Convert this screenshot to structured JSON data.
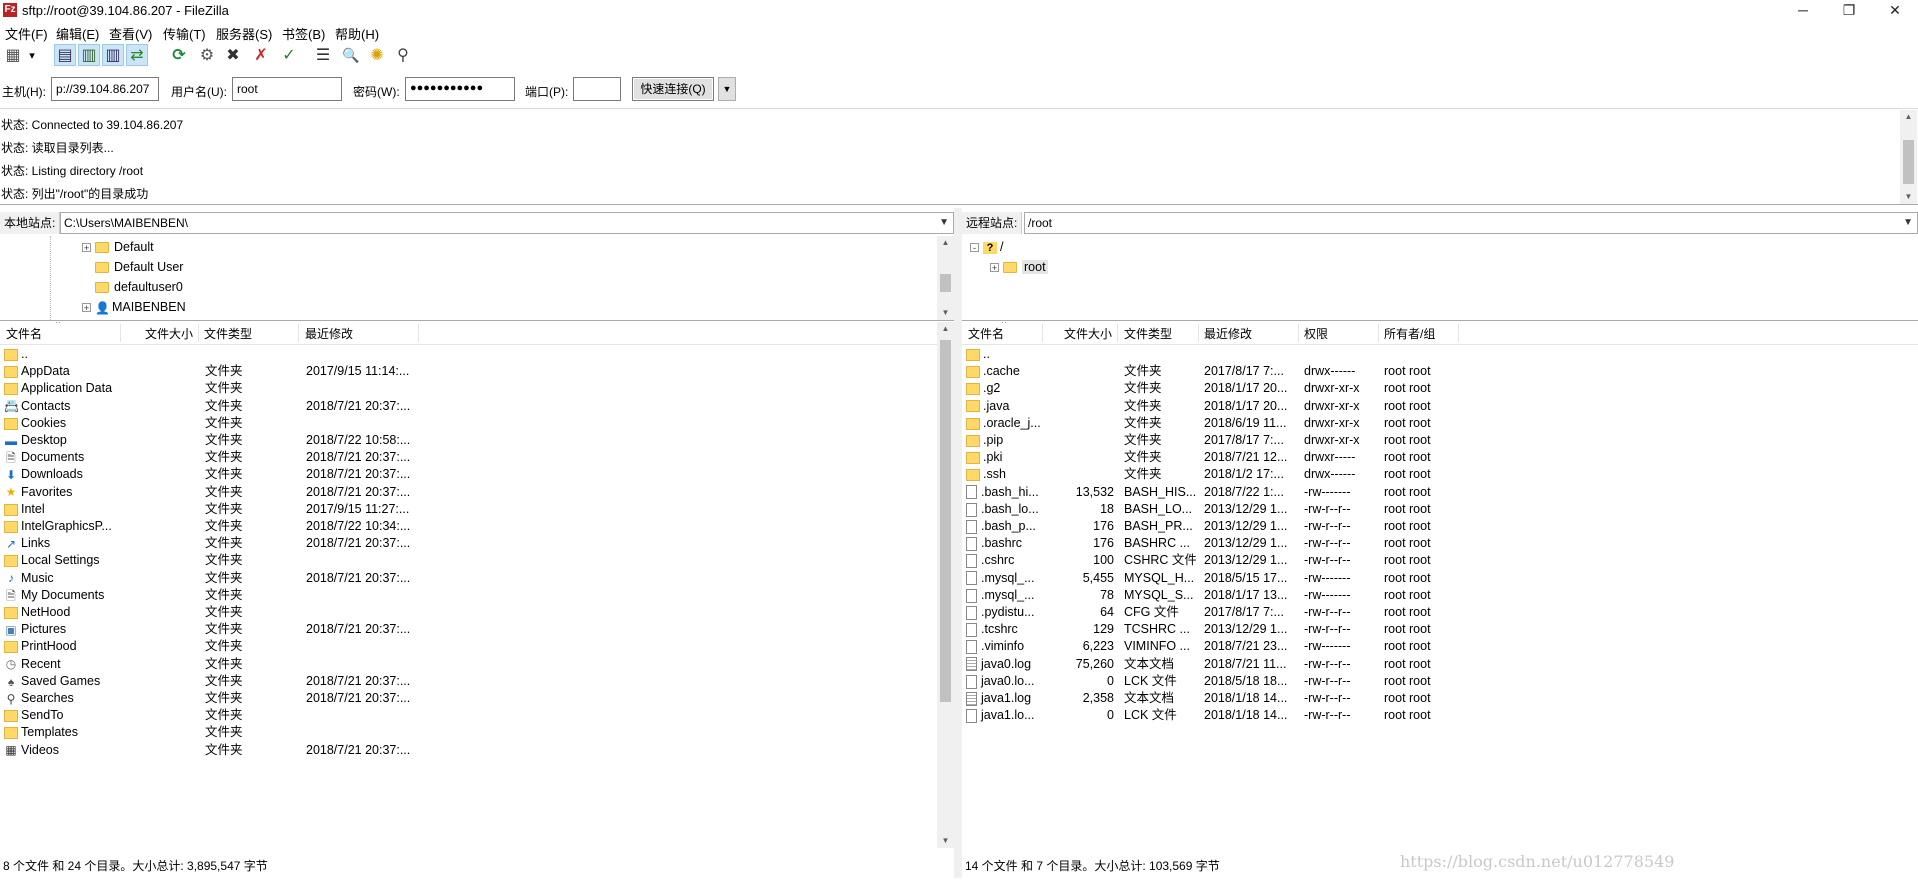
{
  "window": {
    "title": "sftp://root@39.104.86.207 - FileZilla",
    "app_icon": "Fz",
    "minimize": "─",
    "maximize": "❐",
    "close": "✕"
  },
  "menu": [
    "文件(F)",
    "编辑(E)",
    "查看(V)",
    "传输(T)",
    "服务器(S)",
    "书签(B)",
    "帮助(H)"
  ],
  "toolbar": [
    {
      "name": "site-manager-icon",
      "glyph": "▦"
    },
    {
      "name": "site-manager-dropdown-icon",
      "glyph": "▾"
    },
    {
      "name": "toggle-log-icon",
      "glyph": "▤"
    },
    {
      "name": "toggle-local-tree-icon",
      "glyph": "▥"
    },
    {
      "name": "toggle-remote-tree-icon",
      "glyph": "▥"
    },
    {
      "name": "toggle-queue-icon",
      "glyph": "⇄"
    },
    {
      "name": "refresh-icon",
      "glyph": "⟳"
    },
    {
      "name": "process-queue-icon",
      "glyph": "⚙"
    },
    {
      "name": "cancel-icon",
      "glyph": "✖"
    },
    {
      "name": "disconnect-icon",
      "glyph": "✗"
    },
    {
      "name": "reconnect-icon",
      "glyph": "✓"
    },
    {
      "name": "directory-comparison-icon",
      "glyph": "☰"
    },
    {
      "name": "filter-icon",
      "glyph": "🔍"
    },
    {
      "name": "sync-browsing-icon",
      "glyph": "✺"
    },
    {
      "name": "search-files-icon",
      "glyph": "⚲"
    }
  ],
  "quickconnect": {
    "host_label": "主机(H):",
    "host_value": "p://39.104.86.207",
    "user_label": "用户名(U):",
    "user_value": "root",
    "password_label": "密码(W):",
    "password_value": "●●●●●●●●●●●",
    "port_label": "端口(P):",
    "port_value": "",
    "button_label": "快速连接(Q)",
    "dropdown_glyph": "▼"
  },
  "log": [
    "状态: Connected to 39.104.86.207",
    "状态: 读取目录列表...",
    "状态: Listing directory /root",
    "状态: 列出\"/root\"的目录成功"
  ],
  "local": {
    "site_label": "本地站点:",
    "path": "C:\\Users\\MAIBENBEN\\",
    "tree": [
      {
        "label": "Default",
        "expander": "+",
        "icon": "folder"
      },
      {
        "label": "Default User",
        "expander": "",
        "icon": "folder"
      },
      {
        "label": "defaultuser0",
        "expander": "",
        "icon": "folder"
      },
      {
        "label": "MAIBENBEN",
        "expander": "+",
        "icon": "user"
      }
    ],
    "headers": [
      "文件名",
      "文件大小",
      "文件类型",
      "最近修改"
    ],
    "rows": [
      {
        "name": "..",
        "size": "",
        "type": "",
        "modified": "",
        "icon": "folder"
      },
      {
        "name": "AppData",
        "size": "",
        "type": "文件夹",
        "modified": "2017/9/15 11:14:...",
        "icon": "folder"
      },
      {
        "name": "Application Data",
        "size": "",
        "type": "文件夹",
        "modified": "",
        "icon": "folder"
      },
      {
        "name": "Contacts",
        "size": "",
        "type": "文件夹",
        "modified": "2018/7/21 20:37:...",
        "icon": "contacts"
      },
      {
        "name": "Cookies",
        "size": "",
        "type": "文件夹",
        "modified": "",
        "icon": "folder"
      },
      {
        "name": "Desktop",
        "size": "",
        "type": "文件夹",
        "modified": "2018/7/22 10:58:...",
        "icon": "desktop"
      },
      {
        "name": "Documents",
        "size": "",
        "type": "文件夹",
        "modified": "2018/7/21 20:37:...",
        "icon": "documents"
      },
      {
        "name": "Downloads",
        "size": "",
        "type": "文件夹",
        "modified": "2018/7/21 20:37:...",
        "icon": "downloads"
      },
      {
        "name": "Favorites",
        "size": "",
        "type": "文件夹",
        "modified": "2018/7/21 20:37:...",
        "icon": "star"
      },
      {
        "name": "Intel",
        "size": "",
        "type": "文件夹",
        "modified": "2017/9/15 11:27:...",
        "icon": "folder"
      },
      {
        "name": "IntelGraphicsP...",
        "size": "",
        "type": "文件夹",
        "modified": "2018/7/22 10:34:...",
        "icon": "folder"
      },
      {
        "name": "Links",
        "size": "",
        "type": "文件夹",
        "modified": "2018/7/21 20:37:...",
        "icon": "links"
      },
      {
        "name": "Local Settings",
        "size": "",
        "type": "文件夹",
        "modified": "",
        "icon": "folder"
      },
      {
        "name": "Music",
        "size": "",
        "type": "文件夹",
        "modified": "2018/7/21 20:37:...",
        "icon": "music"
      },
      {
        "name": "My Documents",
        "size": "",
        "type": "文件夹",
        "modified": "",
        "icon": "documents"
      },
      {
        "name": "NetHood",
        "size": "",
        "type": "文件夹",
        "modified": "",
        "icon": "folder"
      },
      {
        "name": "Pictures",
        "size": "",
        "type": "文件夹",
        "modified": "2018/7/21 20:37:...",
        "icon": "pictures"
      },
      {
        "name": "PrintHood",
        "size": "",
        "type": "文件夹",
        "modified": "",
        "icon": "folder"
      },
      {
        "name": "Recent",
        "size": "",
        "type": "文件夹",
        "modified": "",
        "icon": "recent"
      },
      {
        "name": "Saved Games",
        "size": "",
        "type": "文件夹",
        "modified": "2018/7/21 20:37:...",
        "icon": "games"
      },
      {
        "name": "Searches",
        "size": "",
        "type": "文件夹",
        "modified": "2018/7/21 20:37:...",
        "icon": "search"
      },
      {
        "name": "SendTo",
        "size": "",
        "type": "文件夹",
        "modified": "",
        "icon": "folder"
      },
      {
        "name": "Templates",
        "size": "",
        "type": "文件夹",
        "modified": "",
        "icon": "folder"
      },
      {
        "name": "Videos",
        "size": "",
        "type": "文件夹",
        "modified": "2018/7/21 20:37:...",
        "icon": "videos"
      }
    ],
    "status": "8 个文件 和 24 个目录。大小总计: 3,895,547 字节"
  },
  "remote": {
    "site_label": "远程站点:",
    "path": "/root",
    "tree": [
      {
        "label": "/",
        "expander": "-",
        "icon": "unknown"
      },
      {
        "label": "root",
        "expander": "+",
        "icon": "folder"
      }
    ],
    "headers": [
      "文件名",
      "文件大小",
      "文件类型",
      "最近修改",
      "权限",
      "所有者/组"
    ],
    "rows": [
      {
        "name": "..",
        "size": "",
        "type": "",
        "modified": "",
        "perm": "",
        "owner": "",
        "icon": "folder"
      },
      {
        "name": ".cache",
        "size": "",
        "type": "文件夹",
        "modified": "2017/8/17 7:...",
        "perm": "drwx------",
        "owner": "root root",
        "icon": "folder"
      },
      {
        "name": ".g2",
        "size": "",
        "type": "文件夹",
        "modified": "2018/1/17 20...",
        "perm": "drwxr-xr-x",
        "owner": "root root",
        "icon": "folder"
      },
      {
        "name": ".java",
        "size": "",
        "type": "文件夹",
        "modified": "2018/1/17 20...",
        "perm": "drwxr-xr-x",
        "owner": "root root",
        "icon": "folder"
      },
      {
        "name": ".oracle_j...",
        "size": "",
        "type": "文件夹",
        "modified": "2018/6/19 11...",
        "perm": "drwxr-xr-x",
        "owner": "root root",
        "icon": "folder"
      },
      {
        "name": ".pip",
        "size": "",
        "type": "文件夹",
        "modified": "2017/8/17 7:...",
        "perm": "drwxr-xr-x",
        "owner": "root root",
        "icon": "folder"
      },
      {
        "name": ".pki",
        "size": "",
        "type": "文件夹",
        "modified": "2018/7/21 12...",
        "perm": "drwxr-----",
        "owner": "root root",
        "icon": "folder"
      },
      {
        "name": ".ssh",
        "size": "",
        "type": "文件夹",
        "modified": "2018/1/2 17:...",
        "perm": "drwx------",
        "owner": "root root",
        "icon": "folder"
      },
      {
        "name": ".bash_hi...",
        "size": "13,532",
        "type": "BASH_HIS...",
        "modified": "2018/7/22 1:...",
        "perm": "-rw-------",
        "owner": "root root",
        "icon": "file"
      },
      {
        "name": ".bash_lo...",
        "size": "18",
        "type": "BASH_LO...",
        "modified": "2013/12/29 1...",
        "perm": "-rw-r--r--",
        "owner": "root root",
        "icon": "file"
      },
      {
        "name": ".bash_p...",
        "size": "176",
        "type": "BASH_PR...",
        "modified": "2013/12/29 1...",
        "perm": "-rw-r--r--",
        "owner": "root root",
        "icon": "file"
      },
      {
        "name": ".bashrc",
        "size": "176",
        "type": "BASHRC ...",
        "modified": "2013/12/29 1...",
        "perm": "-rw-r--r--",
        "owner": "root root",
        "icon": "file"
      },
      {
        "name": ".cshrc",
        "size": "100",
        "type": "CSHRC 文件",
        "modified": "2013/12/29 1...",
        "perm": "-rw-r--r--",
        "owner": "root root",
        "icon": "file"
      },
      {
        "name": ".mysql_...",
        "size": "5,455",
        "type": "MYSQL_H...",
        "modified": "2018/5/15 17...",
        "perm": "-rw-------",
        "owner": "root root",
        "icon": "file"
      },
      {
        "name": ".mysql_...",
        "size": "78",
        "type": "MYSQL_S...",
        "modified": "2018/1/17 13...",
        "perm": "-rw-------",
        "owner": "root root",
        "icon": "file"
      },
      {
        "name": ".pydistu...",
        "size": "64",
        "type": "CFG 文件",
        "modified": "2017/8/17 7:...",
        "perm": "-rw-r--r--",
        "owner": "root root",
        "icon": "file"
      },
      {
        "name": ".tcshrc",
        "size": "129",
        "type": "TCSHRC ...",
        "modified": "2013/12/29 1...",
        "perm": "-rw-r--r--",
        "owner": "root root",
        "icon": "file"
      },
      {
        "name": ".viminfo",
        "size": "6,223",
        "type": "VIMINFO ...",
        "modified": "2018/7/21 23...",
        "perm": "-rw-------",
        "owner": "root root",
        "icon": "file"
      },
      {
        "name": "java0.log",
        "size": "75,260",
        "type": "文本文档",
        "modified": "2018/7/21 11...",
        "perm": "-rw-r--r--",
        "owner": "root root",
        "icon": "textfile"
      },
      {
        "name": "java0.lo...",
        "size": "0",
        "type": "LCK 文件",
        "modified": "2018/5/18 18...",
        "perm": "-rw-r--r--",
        "owner": "root root",
        "icon": "file"
      },
      {
        "name": "java1.log",
        "size": "2,358",
        "type": "文本文档",
        "modified": "2018/1/18 14...",
        "perm": "-rw-r--r--",
        "owner": "root root",
        "icon": "textfile"
      },
      {
        "name": "java1.lo...",
        "size": "0",
        "type": "LCK 文件",
        "modified": "2018/1/18 14...",
        "perm": "-rw-r--r--",
        "owner": "root root",
        "icon": "file"
      }
    ],
    "status": "14 个文件 和 7 个目录。大小总计: 103,569 字节"
  },
  "watermark": "https://blog.csdn.net/u012778549",
  "colors": {
    "folder": "#ffd86a",
    "selection": "#cce4f7",
    "border": "#aaaaaa"
  }
}
